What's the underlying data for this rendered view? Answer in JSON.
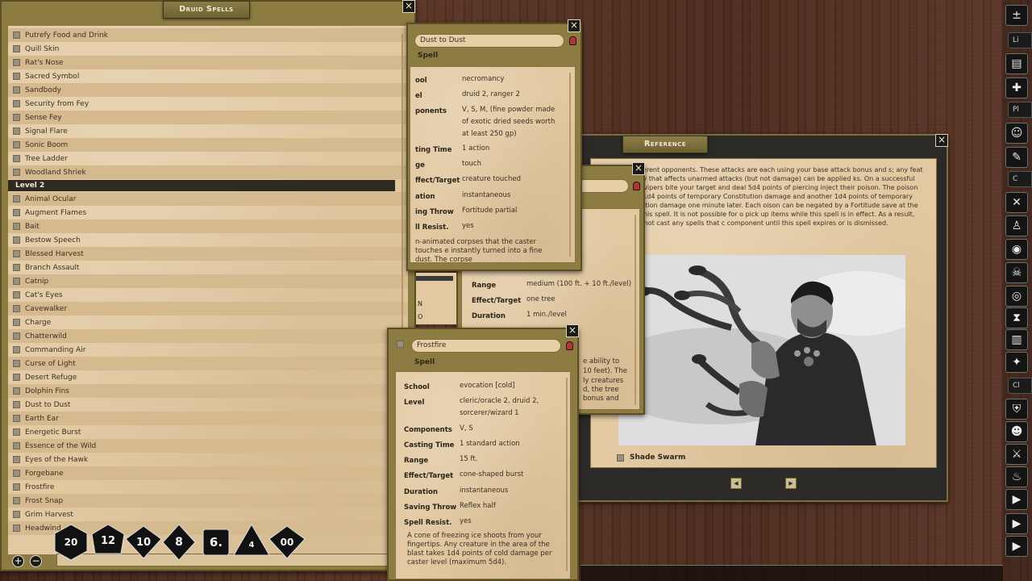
{
  "druid_spells": {
    "title": "Druid Spells",
    "rows_before": [
      "Putrefy Food and Drink",
      "Quill Skin",
      "Rat's Nose",
      "Sacred Symbol",
      "Sandbody",
      "Security from Fey",
      "Sense Fey",
      "Signal Flare",
      "Sonic Boom",
      "Tree Ladder",
      "Woodland Shriek"
    ],
    "level_header": "Level 2",
    "rows_after": [
      "Animal Ocular",
      "Augment Flames",
      "Bait",
      "Bestow Speech",
      "Blessed Harvest",
      "Branch Assault",
      "Catnip",
      "Cat's Eyes",
      "Cavewalker",
      "Charge",
      "Chatterwild",
      "Commanding Air",
      "Curse of Light",
      "Desert Refuge",
      "Dolphin Fins",
      "Dust to Dust",
      "Earth Ear",
      "Energetic Burst",
      "Essence of the Wild",
      "Eyes of the Hawk",
      "Forgebane",
      "Frostfire",
      "Frost Snap",
      "Grim Harvest",
      "Headwind"
    ],
    "add_icon": "+",
    "remove_icon": "−"
  },
  "dust_to_dust": {
    "name": "Dust to Dust",
    "subtitle": "Spell",
    "labels": {
      "school": "School",
      "level": "Level",
      "components": "Components",
      "casting_time": "Casting Time",
      "range": "Range",
      "effect": "Effect/Target",
      "duration": "Duration",
      "saving_throw": "Saving Throw",
      "spell_resist": "Spell Resist."
    },
    "visible_labels": {
      "school": "ool",
      "level": "el",
      "components": "ponents",
      "casting_time": "ting Time",
      "range": "ge",
      "effect": "ffect/Target",
      "duration": "ation",
      "saving_throw": "ing Throw",
      "spell_resist": "ll Resist."
    },
    "school": "necromancy",
    "level": "druid 2, ranger 2",
    "components": "V, S, M, (fine powder made of exotic dried seeds worth at least 250 gp)",
    "casting_time": "1 action",
    "range": "touch",
    "effect": "creature touched",
    "duration": "instantaneous",
    "saving_throw": "Fortitude partial",
    "spell_resist": "yes",
    "description": "n-animated corpses that the caster touches e instantly turned into a fine dust. The corpse"
  },
  "hidden_spell": {
    "range_label": "Range",
    "range": "medium (100 ft. + 10 ft./level)",
    "effect_label": "Effect/Target",
    "effect": "one tree",
    "duration_label": "Duration",
    "duration": "1 min./level",
    "frag_n": "N",
    "frag_o": "O",
    "desc_lines": [
      "e ability to",
      "10 feet). The",
      "ly creatures",
      "d, the tree",
      "bonus and"
    ]
  },
  "frostfire": {
    "name": "Frostfire",
    "subtitle": "Spell",
    "labels": {
      "school": "School",
      "level": "Level",
      "components": "Components",
      "casting_time": "Casting Time",
      "range": "Range",
      "effect": "Effect/Target",
      "duration": "Duration",
      "saving_throw": "Saving Throw",
      "spell_resist": "Spell Resist."
    },
    "school": "evocation [cold]",
    "level": "cleric/oracle 2, druid 2, sorcerer/wizard 1",
    "components": "V, S",
    "casting_time": "1 standard action",
    "range": "15 ft.",
    "effect": "cone-shaped burst",
    "duration": "instantaneous",
    "saving_throw": "Reflex half",
    "spell_resist": "yes",
    "description": "A cone of freezing ice shoots from your fingertips. Any creature in the area of the blast takes 1d4 points of cold damage per caster level (maximum 5d4)."
  },
  "reference": {
    "title": "Reference",
    "text": "two different opponents. These attacks are each using your base attack bonus and s; any feat or ability that affects unarmed attacks (but not damage) can be applied ks. On a successful hit, the vipers bite your target and deal 5d4 points of piercing inject their poison. The poison causes 1d4 points of temporary Constitution damage and another 1d4 points of temporary Constitution damage one minute later. Each oison can be negated by a Fortitude save at the DC for this spell. It is not possible for o pick up items while this spell is in effect. As a result, you cannot cast any spells that c component until this spell expires or is dismissed.",
    "caption": "Shade Swarm",
    "prev_icon": "◀",
    "next_icon": "▶"
  },
  "dice": [
    "20",
    "12",
    "10",
    "8",
    "6.",
    "4",
    "00"
  ],
  "sidebar_tabs": [
    "Li",
    "Pl",
    "C",
    "Cl"
  ],
  "sidebar_icons": [
    "dice-modifier-icon",
    "library-icon",
    "gear-cross-icon",
    "players-icon",
    "notes-icon",
    "swords-icon",
    "character-icon",
    "potion-icon",
    "skull-icon",
    "coins-icon",
    "hourglass-icon",
    "book-icon",
    "battle-icon",
    "shield-icon",
    "monster-icon",
    "crossed-swords-icon",
    "fire-icon",
    "arrow-right-icon"
  ],
  "colors": {
    "parchment": "#e2c9a2",
    "frame": "#8d7c42",
    "wood": "#4a2a1e"
  }
}
